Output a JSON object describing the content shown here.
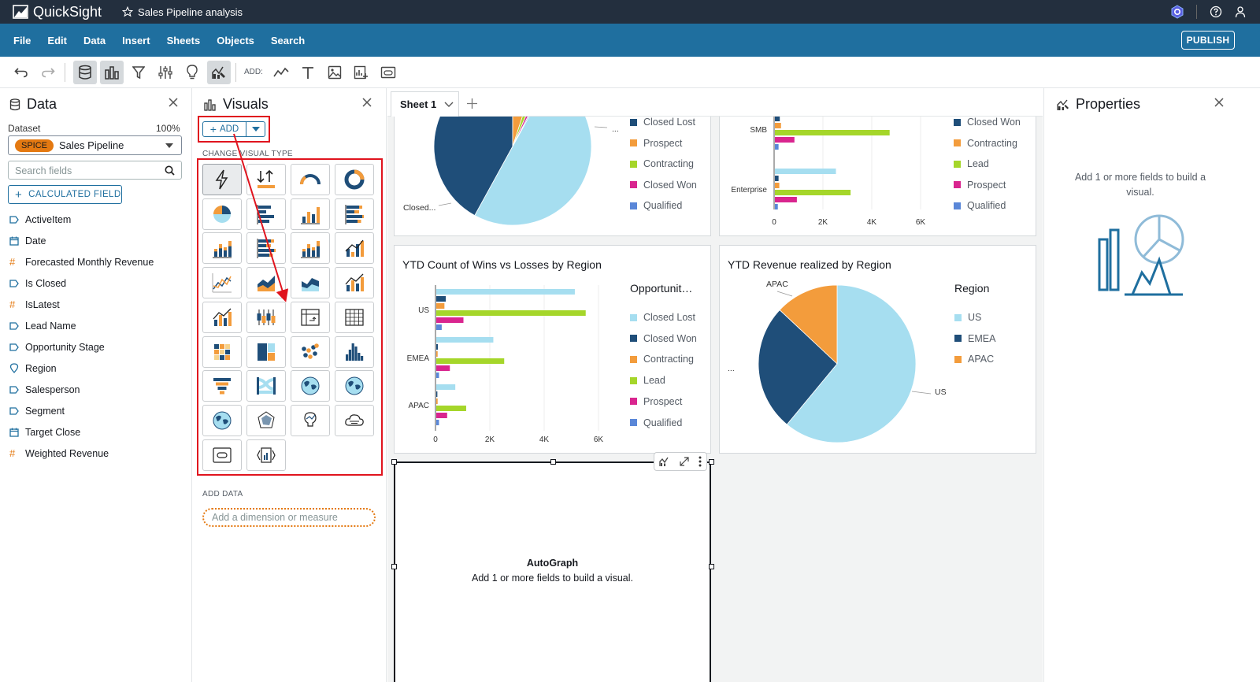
{
  "app": {
    "name": "QuickSight",
    "analysis_name": "Sales Pipeline analysis"
  },
  "menu": [
    "File",
    "Edit",
    "Data",
    "Insert",
    "Sheets",
    "Objects",
    "Search"
  ],
  "publish_label": "PUBLISH",
  "toolbar": {
    "add_label": "ADD:"
  },
  "data_panel": {
    "title": "Data",
    "dataset_label": "Dataset",
    "dataset_percent": "100%",
    "spice_badge": "SPICE",
    "dataset_name": "Sales Pipeline",
    "search_placeholder": "Search fields",
    "calculated_field_label": "CALCULATED FIELD",
    "fields": [
      {
        "name": "ActiveItem",
        "type": "dimension"
      },
      {
        "name": "Date",
        "type": "date"
      },
      {
        "name": "Forecasted Monthly Revenue",
        "type": "measure"
      },
      {
        "name": "Is Closed",
        "type": "dimension"
      },
      {
        "name": "IsLatest",
        "type": "measure"
      },
      {
        "name": "Lead Name",
        "type": "dimension"
      },
      {
        "name": "Opportunity Stage",
        "type": "dimension"
      },
      {
        "name": "Region",
        "type": "geo"
      },
      {
        "name": "Salesperson",
        "type": "dimension"
      },
      {
        "name": "Segment",
        "type": "dimension"
      },
      {
        "name": "Target Close",
        "type": "date"
      },
      {
        "name": "Weighted Revenue",
        "type": "measure"
      }
    ]
  },
  "visuals_panel": {
    "title": "Visuals",
    "add_label": "ADD",
    "change_visual_type_label": "CHANGE VISUAL TYPE",
    "add_data_label": "ADD DATA",
    "add_dimension_placeholder": "Add a dimension or measure",
    "visual_types": [
      "autograph",
      "kpi",
      "gauge",
      "donut",
      "pie",
      "horizontal-bar",
      "vertical-bar",
      "horizontal-stacked-bar",
      "vertical-stacked-bar",
      "horizontal-stacked-100-bar",
      "vertical-stacked-100-bar",
      "combo-bar-line",
      "line",
      "area",
      "stacked-area",
      "bar-line-combo",
      "line-bar-combo",
      "box-plot",
      "pivot-table",
      "table",
      "heat-map",
      "tree-map",
      "scatter",
      "histogram",
      "funnel",
      "sankey",
      "geospatial-points",
      "filled-map",
      "layer-map",
      "radar",
      "insight",
      "word-cloud",
      "custom-content",
      "custom-visual-code"
    ]
  },
  "sheet_tab": {
    "label": "Sheet 1"
  },
  "visuals": {
    "top_left": {
      "legend": [
        {
          "label": "Closed Lost",
          "color": "#1f4e79"
        },
        {
          "label": "Prospect",
          "color": "#f39c3c"
        },
        {
          "label": "Contracting",
          "color": "#a5d62a"
        },
        {
          "label": "Closed Won",
          "color": "#d9258f"
        },
        {
          "label": "Qualified",
          "color": "#5a87d8"
        }
      ],
      "labels": {
        "left": "Closed...",
        "right": "..."
      }
    },
    "top_right": {
      "legend": [
        {
          "label": "Closed Won",
          "color": "#1f4e79"
        },
        {
          "label": "Contracting",
          "color": "#f39c3c"
        },
        {
          "label": "Lead",
          "color": "#a5d62a"
        },
        {
          "label": "Prospect",
          "color": "#d9258f"
        },
        {
          "label": "Qualified",
          "color": "#5a87d8"
        }
      ],
      "categories": [
        "SMB",
        "Enterprise"
      ],
      "x_ticks": [
        "0",
        "2K",
        "4K",
        "6K"
      ]
    },
    "wins_losses": {
      "title": "YTD Count of Wins vs Losses by Region",
      "legend_title": "Opportunit…",
      "legend": [
        {
          "label": "Closed Lost",
          "color": "#a6def0"
        },
        {
          "label": "Closed Won",
          "color": "#1f4e79"
        },
        {
          "label": "Contracting",
          "color": "#f39c3c"
        },
        {
          "label": "Lead",
          "color": "#a5d62a"
        },
        {
          "label": "Prospect",
          "color": "#d9258f"
        },
        {
          "label": "Qualified",
          "color": "#5a87d8"
        }
      ],
      "categories": [
        "US",
        "EMEA",
        "APAC"
      ],
      "x_ticks": [
        "0",
        "2K",
        "4K",
        "6K"
      ]
    },
    "revenue_region": {
      "title": "YTD Revenue realized by Region",
      "legend_title": "Region",
      "legend": [
        {
          "label": "US",
          "color": "#a6def0"
        },
        {
          "label": "EMEA",
          "color": "#1f4e79"
        },
        {
          "label": "APAC",
          "color": "#f39c3c"
        }
      ],
      "labels": {
        "apac": "APAC",
        "emea": "...",
        "us": "US"
      }
    },
    "autograph": {
      "title": "AutoGraph",
      "message": "Add 1 or more fields to build a visual."
    }
  },
  "properties_panel": {
    "title": "Properties",
    "message": "Add 1 or more fields to build a visual."
  },
  "chart_data": [
    {
      "type": "pie",
      "title": "",
      "categories": [
        "Closed Lost",
        "Prospect",
        "Contracting",
        "Closed Won",
        "Qualified",
        "Other"
      ],
      "values": [
        42,
        5,
        1.5,
        1,
        0.5,
        50
      ]
    },
    {
      "type": "bar",
      "title": "",
      "orientation": "horizontal",
      "categories": [
        "SMB",
        "Enterprise"
      ],
      "series": [
        {
          "name": "Closed Lost",
          "values": [
            4300,
            2500
          ]
        },
        {
          "name": "Closed Won",
          "values": [
            200,
            150
          ]
        },
        {
          "name": "Contracting",
          "values": [
            250,
            180
          ]
        },
        {
          "name": "Lead",
          "values": [
            4700,
            3100
          ]
        },
        {
          "name": "Prospect",
          "values": [
            800,
            900
          ]
        },
        {
          "name": "Qualified",
          "values": [
            150,
            120
          ]
        }
      ],
      "xlim": [
        0,
        6500
      ]
    },
    {
      "type": "bar",
      "title": "YTD Count of Wins vs Losses by Region",
      "orientation": "horizontal",
      "legend_title": "Opportunit…",
      "categories": [
        "US",
        "EMEA",
        "APAC"
      ],
      "series": [
        {
          "name": "Closed Lost",
          "values": [
            5100,
            2100,
            700
          ]
        },
        {
          "name": "Closed Won",
          "values": [
            350,
            60,
            40
          ]
        },
        {
          "name": "Contracting",
          "values": [
            300,
            50,
            50
          ]
        },
        {
          "name": "Lead",
          "values": [
            5500,
            2500,
            1100
          ]
        },
        {
          "name": "Prospect",
          "values": [
            1000,
            500,
            400
          ]
        },
        {
          "name": "Qualified",
          "values": [
            200,
            100,
            100
          ]
        }
      ],
      "xlim": [
        0,
        6500
      ]
    },
    {
      "type": "pie",
      "title": "YTD Revenue realized by Region",
      "legend_title": "Region",
      "categories": [
        "US",
        "EMEA",
        "APAC"
      ],
      "values": [
        61,
        26,
        13
      ]
    }
  ]
}
